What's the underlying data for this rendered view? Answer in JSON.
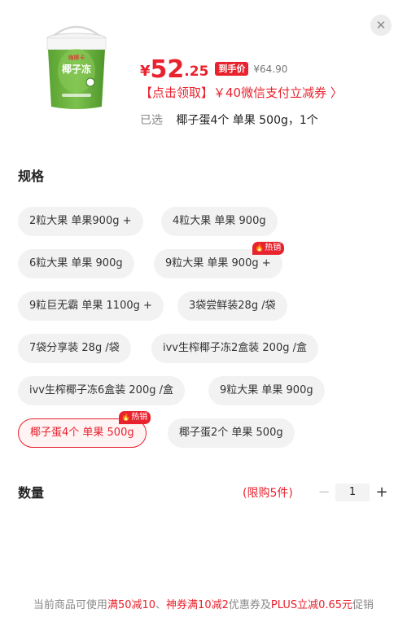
{
  "close_icon": "close-icon",
  "product": {
    "image_icon": "coconut-bucket-product-image",
    "brand": "嗨椰卡",
    "name": "椰子冻"
  },
  "price": {
    "currency": "¥",
    "integer": "52",
    "decimal": ".25",
    "badge": "到手价",
    "original": "¥64.90"
  },
  "coupon": {
    "text": "【点击领取】￥40微信支付立减券 〉"
  },
  "selected": {
    "label": "已选",
    "value": "椰子蛋4个 单果 500g，1个"
  },
  "spec": {
    "title": "规格",
    "hot_label": "热销",
    "options": [
      "2粒大果 单果900g +",
      "4粒大果 单果 900g",
      "6粒大果 单果 900g",
      "9粒大果 单果 900g +",
      "9粒巨无霸 单果 1100g +",
      "3袋尝鲜装28g /袋",
      "7袋分享装 28g /袋",
      "ivv生榨椰子冻2盒装 200g /盒",
      "ivv生榨椰子冻6盒装 200g /盒",
      "9粒大果 单果 900g",
      "椰子蛋4个 单果 500g",
      "椰子蛋2个 单果 500g"
    ]
  },
  "quantity": {
    "title": "数量",
    "limit": "(限购5件)",
    "minus": "−",
    "value": "1",
    "plus": "+"
  },
  "promo": {
    "prefix": "当前商品可使用",
    "deal1": "满50减10",
    "sep": "、",
    "deal2": "神券满10减2",
    "mid": "优惠券及",
    "deal3": "PLUS立减0.65元",
    "suffix": "促销"
  },
  "colors": {
    "accent": "#e8222e",
    "chip_bg": "#f2f2f2",
    "product_green": "#6cb33f"
  }
}
